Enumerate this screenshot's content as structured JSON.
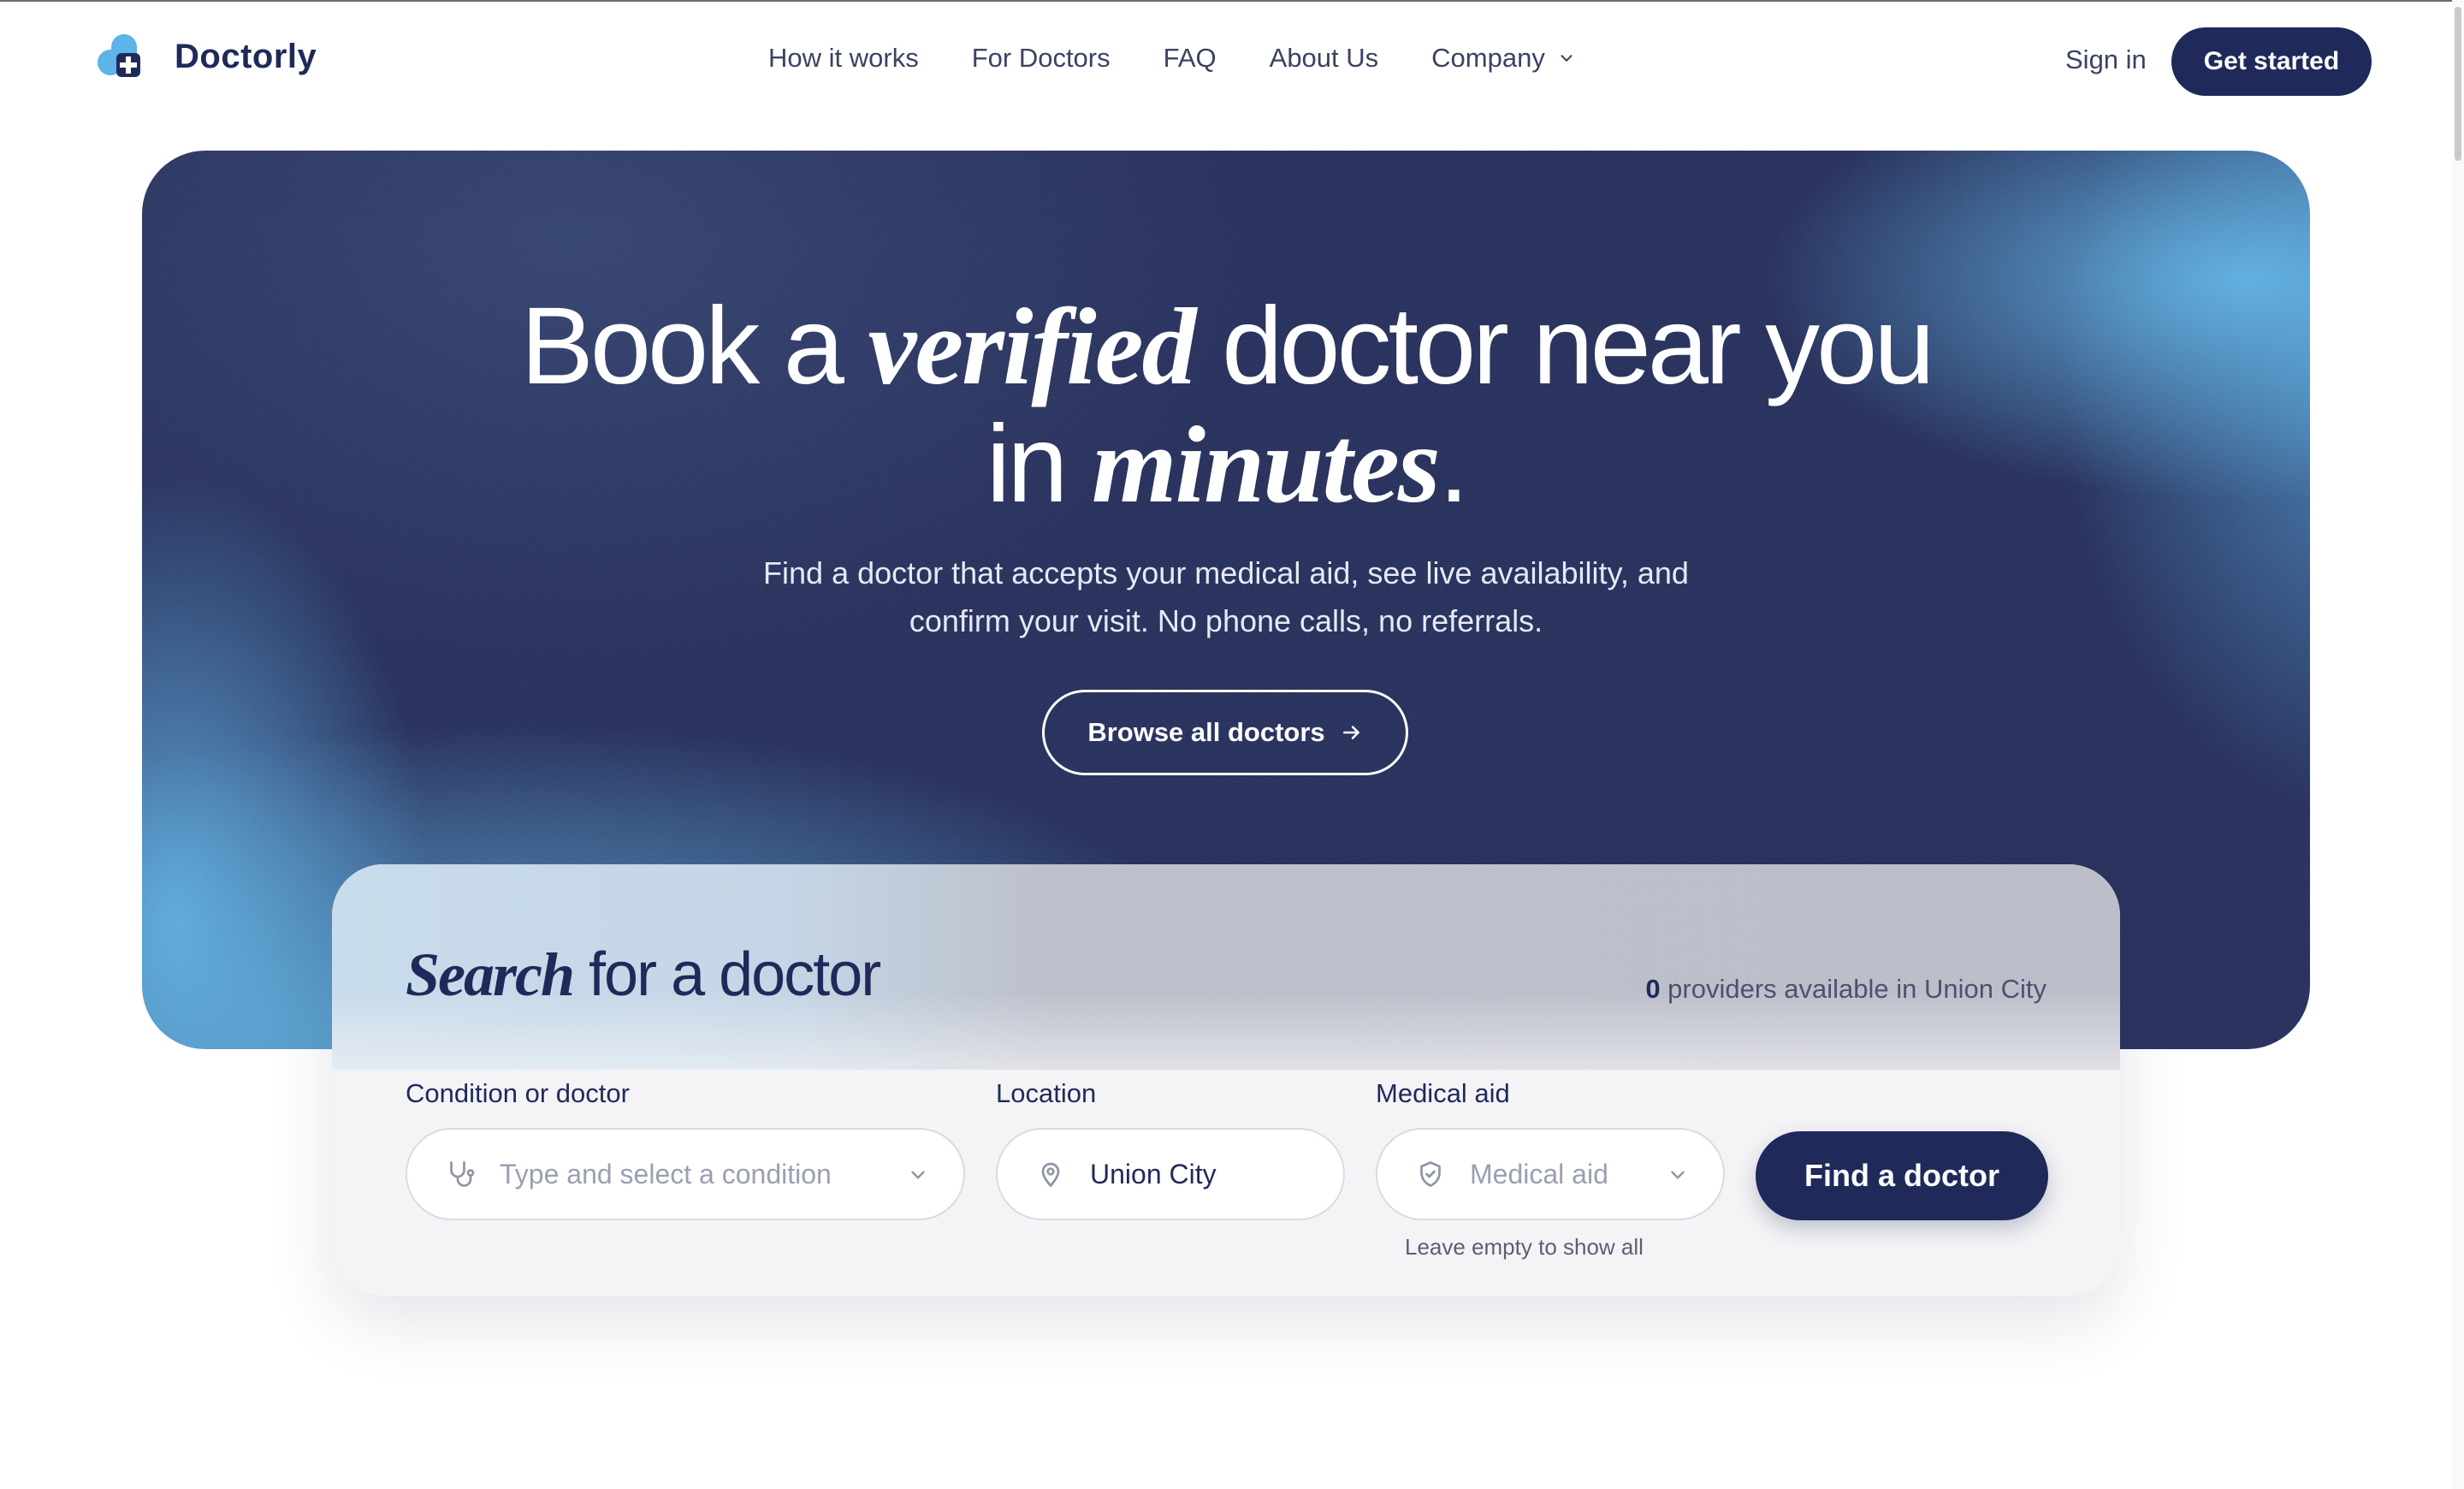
{
  "brand": {
    "name": "Doctorly",
    "colors": {
      "navy": "#1f2a5a",
      "light_blue": "#5cb4e8"
    }
  },
  "nav": {
    "links": [
      "How it works",
      "For Doctors",
      "FAQ",
      "About Us"
    ],
    "company": "Company",
    "sign_in": "Sign in",
    "get_started": "Get started"
  },
  "hero": {
    "title_pre": "Book a ",
    "title_em1": "verified",
    "title_mid": " doctor near you",
    "title_line2_pre": "in ",
    "title_em2": "minutes",
    "title_end": ".",
    "subtitle_line1": "Find a doctor that accepts your medical aid, see live availability, and",
    "subtitle_line2": "confirm your visit. No phone calls, no referrals.",
    "browse_button": "Browse all doctors"
  },
  "search": {
    "title_em": "Search",
    "title_rest": " for a doctor",
    "providers_count": "0",
    "providers_text": " providers available in Union City",
    "condition": {
      "label": "Condition or doctor",
      "placeholder": "Type and select a condition",
      "icon": "stethoscope-icon"
    },
    "location": {
      "label": "Location",
      "value": "Union City",
      "icon": "map-pin-icon"
    },
    "medical_aid": {
      "label": "Medical aid",
      "placeholder": "Medical aid",
      "icon": "shield-icon",
      "hint": "Leave empty to show all"
    },
    "find_button": "Find a doctor"
  }
}
